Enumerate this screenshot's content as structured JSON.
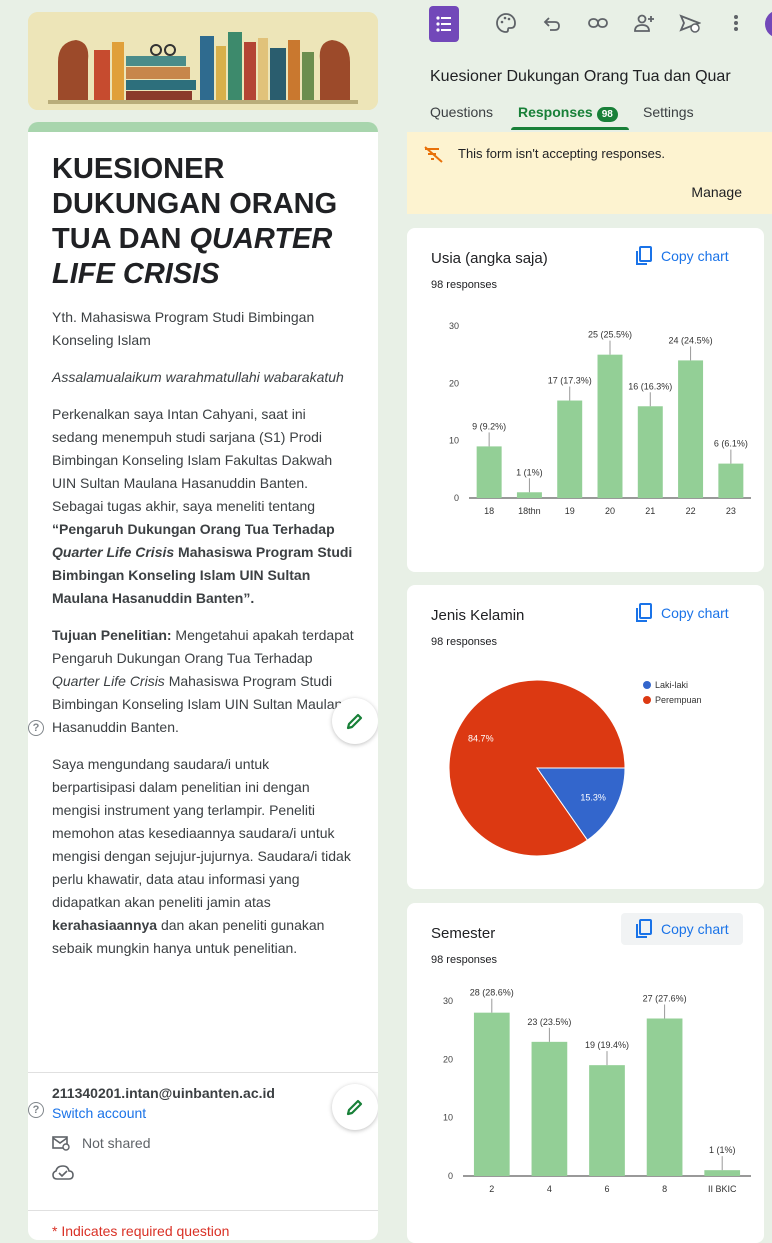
{
  "form": {
    "title_part1": "Kuesioner Dukungan Orang Tua dan ",
    "title_italic": "Quarter Life Crisis",
    "greeting": "Yth. Mahasiswa Program Studi Bimbingan Konseling Islam",
    "salam": "Assalamualaikum warahmatullahi wabarakatuh",
    "intro": "Perkenalkan saya Intan Cahyani, saat ini sedang menempuh studi sarjana (S1) Prodi Bimbingan Konseling Islam Fakultas Dakwah UIN Sultan Maulana Hasanuddin Banten. Sebagai tugas akhir, saya meneliti tentang ",
    "study_bold_1": "“Pengaruh Dukungan Orang Tua Terhadap ",
    "study_bold_italic": "Quarter Life Crisis",
    "study_bold_2": " Mahasiswa Program Studi Bimbingan Konseling Islam UIN Sultan Maulana Hasanuddin Banten”.",
    "purpose_label": "Tujuan Penelitian:",
    "purpose_text_1": " Mengetahui apakah terdapat Pengaruh Dukungan Orang Tua Terhadap ",
    "purpose_italic": "Quarter Life Crisis",
    "purpose_text_2": " Mahasiswa Program Studi Bimbingan Konseling Islam UIN Sultan Maulana Hasanuddin Banten.",
    "invite_1": "Saya mengundang saudara/i untuk berpartisipasi dalam penelitian ini dengan mengisi instrument yang terlampir.  Peneliti memohon atas kesediaannya saudara/i untuk mengisi dengan sejujur-jujurnya. Saudara/i tidak perlu khawatir, data atau informasi yang didapatkan akan peneliti jamin atas ",
    "invite_bold": "kerahasiaannya",
    "invite_2": " dan akan peneliti gunakan sebaik mungkin hanya untuk penelitian.",
    "email": "211340201.intan@uinbanten.ac.id",
    "switch_account": "Switch account",
    "not_shared": "Not shared",
    "required_note": "* Indicates required question",
    "help_glyph": "?"
  },
  "editor": {
    "doc_title": "Kuesioner Dukungan Orang Tua dan Quar",
    "tabs": {
      "questions": "Questions",
      "responses": "Responses",
      "settings": "Settings"
    },
    "response_count": "98",
    "notice": "This form isn't accepting responses.",
    "manage": "Manage",
    "copy_chart": "Copy chart",
    "icons": [
      "forms-app-icon",
      "palette-icon",
      "undo-icon",
      "link-icon",
      "add-person-icon",
      "send-icon",
      "more-vert-icon"
    ]
  },
  "colors": {
    "bar": "#93cf96",
    "female": "#dc3912",
    "male": "#3366cc",
    "accent": "#188038"
  },
  "chart_data": [
    {
      "type": "bar",
      "title": "Usia (angka saja)",
      "subtitle": "98 responses",
      "categories": [
        "18",
        "18thn",
        "19",
        "20",
        "21",
        "22",
        "23"
      ],
      "values": [
        9,
        1,
        17,
        25,
        16,
        24,
        6
      ],
      "labels": [
        "9 (9.2%)",
        "1 (1%)",
        "17 (17.3%)",
        "25 (25.5%)",
        "16 (16.3%)",
        "24 (24.5%)",
        "6 (6.1%)"
      ],
      "yticks": [
        0,
        10,
        20,
        30
      ],
      "ylim": [
        0,
        30
      ]
    },
    {
      "type": "pie",
      "title": "Jenis Kelamin",
      "subtitle": "98 responses",
      "slices": [
        {
          "name": "Laki-laki",
          "value": 15.3,
          "label": "15.3%",
          "color": "#3366cc"
        },
        {
          "name": "Perempuan",
          "value": 84.7,
          "label": "84.7%",
          "color": "#dc3912"
        }
      ],
      "legend": "right"
    },
    {
      "type": "bar",
      "title": "Semester",
      "subtitle": "98 responses",
      "categories": [
        "2",
        "4",
        "6",
        "8",
        "II BKIC"
      ],
      "values": [
        28,
        23,
        19,
        27,
        1
      ],
      "labels": [
        "28 (28.6%)",
        "23 (23.5%)",
        "19 (19.4%)",
        "27 (27.6%)",
        "1 (1%)"
      ],
      "yticks": [
        0,
        10,
        20,
        30
      ],
      "ylim": [
        0,
        30
      ]
    }
  ]
}
